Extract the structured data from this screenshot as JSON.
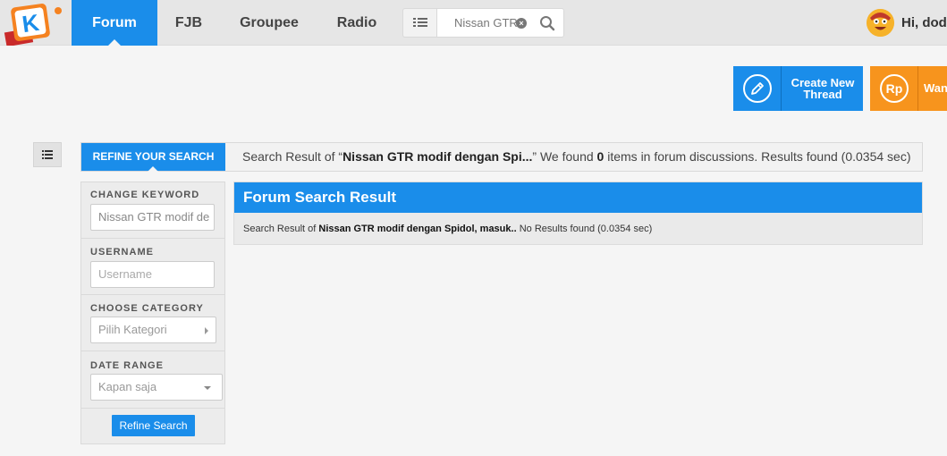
{
  "nav": {
    "tabs": [
      {
        "label": "Forum",
        "active": true
      },
      {
        "label": "FJB",
        "active": false
      },
      {
        "label": "Groupee",
        "active": false
      },
      {
        "label": "Radio",
        "active": false
      }
    ],
    "search_value": "Nissan GTR",
    "greeting": "Hi, dody"
  },
  "actions": {
    "create_label_line1": "Create New",
    "create_label_line2": "Thread",
    "wanted_label": "Wan",
    "wanted_icon_text": "Rp"
  },
  "result_bar": {
    "refine_tab": "REFINE YOUR SEARCH",
    "prefix": "Search Result of “",
    "query": "Nissan GTR modif dengan Spi...",
    "mid": "” We found ",
    "count": "0",
    "suffix": " items in forum discussions. Results found (0.0354 sec)"
  },
  "refine": {
    "keyword_label": "CHANGE KEYWORD",
    "keyword_value": "Nissan GTR modif de",
    "username_label": "USERNAME",
    "username_placeholder": "Username",
    "category_label": "CHOOSE CATEGORY",
    "category_value": "Pilih Kategori",
    "date_label": "DATE RANGE",
    "date_value": "Kapan saja",
    "button": "Refine Search"
  },
  "forum_result": {
    "title": "Forum Search Result",
    "prefix": "Search Result of ",
    "query": "Nissan GTR modif dengan Spidol, masuk..",
    "suffix": " No Results found (0.0354 sec)"
  },
  "colors": {
    "primary": "#1a8dea",
    "orange": "#f7941d"
  },
  "icons": [
    "kaskus-logo-icon",
    "list-icon",
    "clear-icon",
    "search-icon",
    "avatar",
    "pencil-icon",
    "rupiah-icon"
  ]
}
